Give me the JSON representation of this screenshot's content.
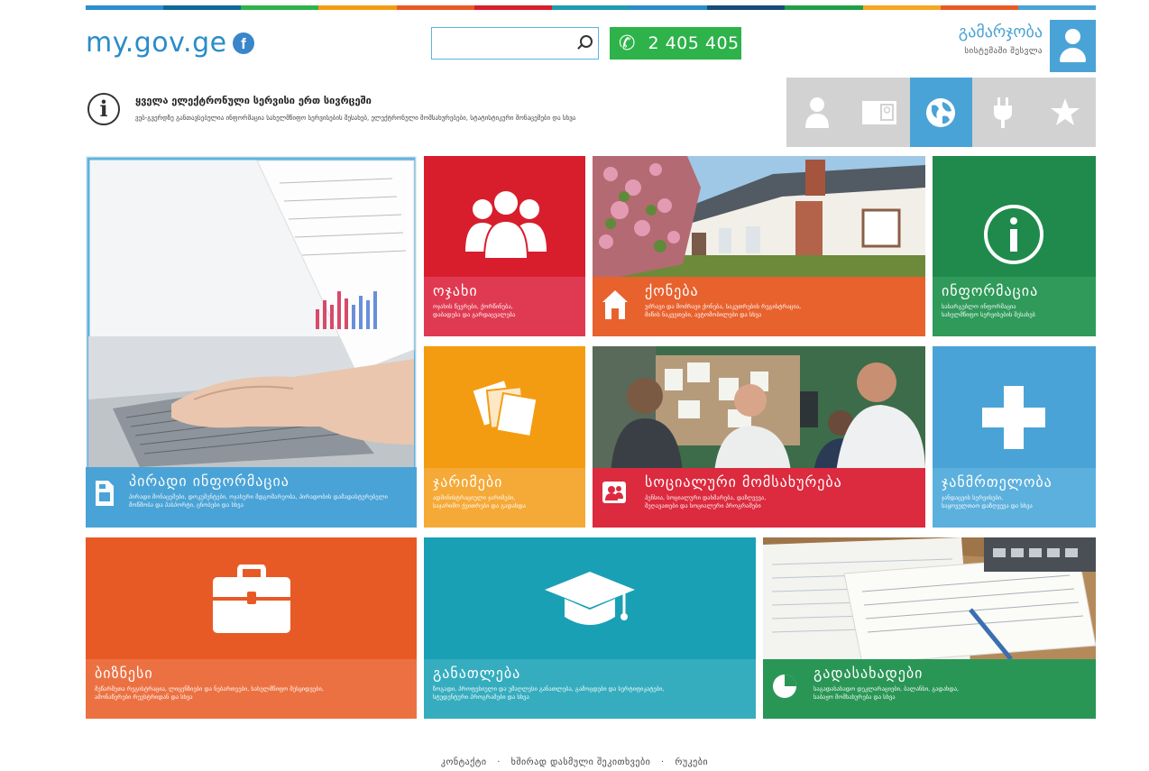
{
  "header": {
    "logo": "my.gov.ge",
    "facebook_label": "f",
    "search": {
      "value": "",
      "placeholder": ""
    },
    "phone": "2 405 405",
    "login": {
      "title": "გამარჯობა",
      "subtitle": "სისტემაში შესვლა"
    }
  },
  "stripe_colors": [
    "#2b8fcf",
    "#0e6a97",
    "#2db34a",
    "#f39c12",
    "#e85a25",
    "#d81e2d",
    "#1f9bb0",
    "#2a8cc8",
    "#164c78",
    "#20a046",
    "#f5a623",
    "#e85a25",
    "#4aa3d6"
  ],
  "notice": {
    "title": "ყველა ელექტრონული სერვისი ერთ სივრცეში",
    "text": "ვებ-გვერდზე განთავსებულია ინფორმაცია სახელმწიფო სერვისების შესახებ, ელექტრონული მომსახურებები, სტატისტიკური მონაცემები და სხვა"
  },
  "category_icons": [
    {
      "name": "person-icon",
      "glyph": "👤"
    },
    {
      "name": "id-card-icon",
      "glyph": "🪪"
    },
    {
      "name": "globe-icon",
      "glyph": "🌐"
    },
    {
      "name": "plug-icon",
      "glyph": "🔌"
    },
    {
      "name": "star-icon",
      "glyph": "★"
    }
  ],
  "tiles": {
    "personal": {
      "title": "პირადი ინფორმაცია",
      "desc1": "პირადი მონაცემები, დოკუმენტები, ოჯახური მდგომარეობა, პირადობის დამადასტურებელი",
      "desc2": "მოწმობა და პასპორტი, ცნობები და სხვა",
      "color": "#4aa3d6"
    },
    "family": {
      "title": "ოჯახი",
      "desc1": "ოჯახის წევრები, ქორწინება,",
      "desc2": "დაბადება და გარდაცვალება",
      "color": "#d81e2d"
    },
    "property": {
      "title": "ქონება",
      "desc1": "უძრავი და მოძრავი ქონება, საკუთრების რეგისტრაცია,",
      "desc2": "მიწის ნაკვეთები, ავტომობილები და სხვა",
      "color": "#e85a25"
    },
    "information": {
      "title": "ინფორმაცია",
      "desc1": "სასარგებლო ინფორმაცია",
      "desc2": "სახელმწიფო სერვისების შესახებ",
      "color": "#1f8a4b"
    },
    "fines": {
      "title": "ჯარიმები",
      "desc1": "ადმინისტრაციული ჯარიმები,",
      "desc2": "საჯარიმო ქვითრები და გადახდა",
      "color": "#f39c12"
    },
    "social": {
      "title": "სოციალური მომსახურება",
      "desc1": "პენსია, სოციალური დახმარება, დაზღვევა,",
      "desc2": "შეღავათები და სოციალური პროგრამები",
      "color": "#d81e2d"
    },
    "health": {
      "title": "ჯანმრთელობა",
      "desc1": "ჯანდაცვის სერვისები,",
      "desc2": "საყოველთაო დაზღვევა და სხვა",
      "color": "#4aa3d6"
    },
    "business": {
      "title": "ბიზნესი",
      "desc1": "მეწარმეთა რეგისტრაცია, ლიცენზიები და ნებართვები, სახელმწიფო შესყიდვები,",
      "desc2": "ამონაწერები რეესტრიდან და სხვა",
      "color": "#e85a25"
    },
    "education": {
      "title": "განათლება",
      "desc1": "ზოგადი, პროფესიული და უმაღლესი განათლება, გამოცდები და სერტიფიკატები,",
      "desc2": "სტუდენტური პროგრამები და სხვა",
      "color": "#1aa0b4"
    },
    "taxes": {
      "title": "გადასახადები",
      "desc1": "საგადასახადო დეკლარაციები, ბალანსი, გადახდა,",
      "desc2": "საბაჟო მომსახურება და სხვა",
      "color": "#1f8a4b"
    }
  },
  "footer": {
    "links": [
      "კონტაქტი",
      "ხშირად დასმული შეკითხვები",
      "რუკები"
    ],
    "separator": "·"
  }
}
